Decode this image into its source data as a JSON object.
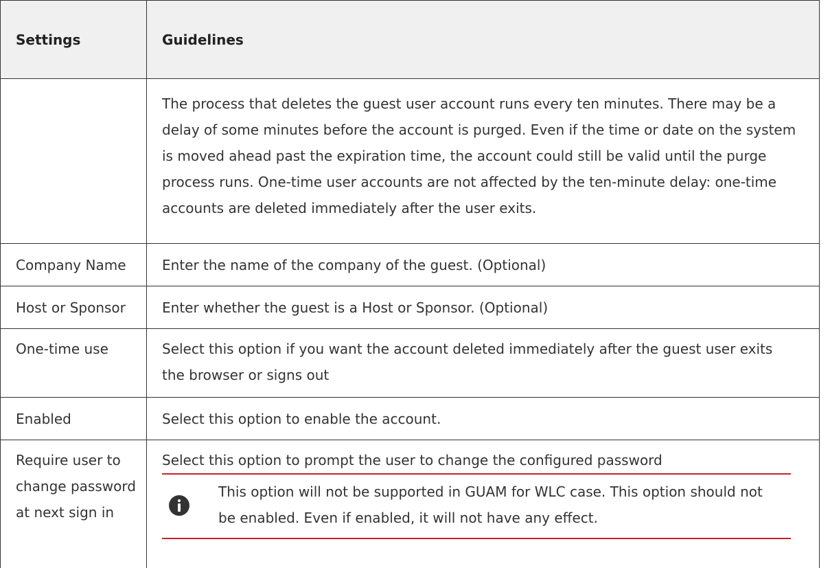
{
  "table": {
    "headers": {
      "settings": "Settings",
      "guidelines": "Guidelines"
    },
    "rows": [
      {
        "setting": "",
        "guideline": "The process that deletes the guest user account runs every ten minutes. There may be a delay of some minutes before the account is purged. Even if the time or date on the system is moved ahead past the expiration time, the account could still be valid until the purge process runs. One-time user accounts are not affected by the ten-minute delay: one-time accounts are deleted immediately after the user exits."
      },
      {
        "setting": "Company Name",
        "guideline": "Enter the name of the company of the guest. (Optional)"
      },
      {
        "setting": "Host or Sponsor",
        "guideline": "Enter whether the guest is a Host or Sponsor. (Optional)"
      },
      {
        "setting": "One-time use",
        "guideline": "Select this option if you want the account deleted immediately after the guest user exits the browser or signs out"
      },
      {
        "setting": "Enabled",
        "guideline": "Select this option to enable the account."
      },
      {
        "setting": "Require user to change password at next sign in",
        "guideline": "Select this option to prompt the user to change the configured password",
        "note": "This option will not be supported in GUAM for WLC case. This option should not be enabled. Even if enabled, it will not have any effect.",
        "note_icon": "info-icon"
      }
    ]
  },
  "colors": {
    "note_rule": "#c8202a",
    "header_bg": "#f0f0f0"
  }
}
